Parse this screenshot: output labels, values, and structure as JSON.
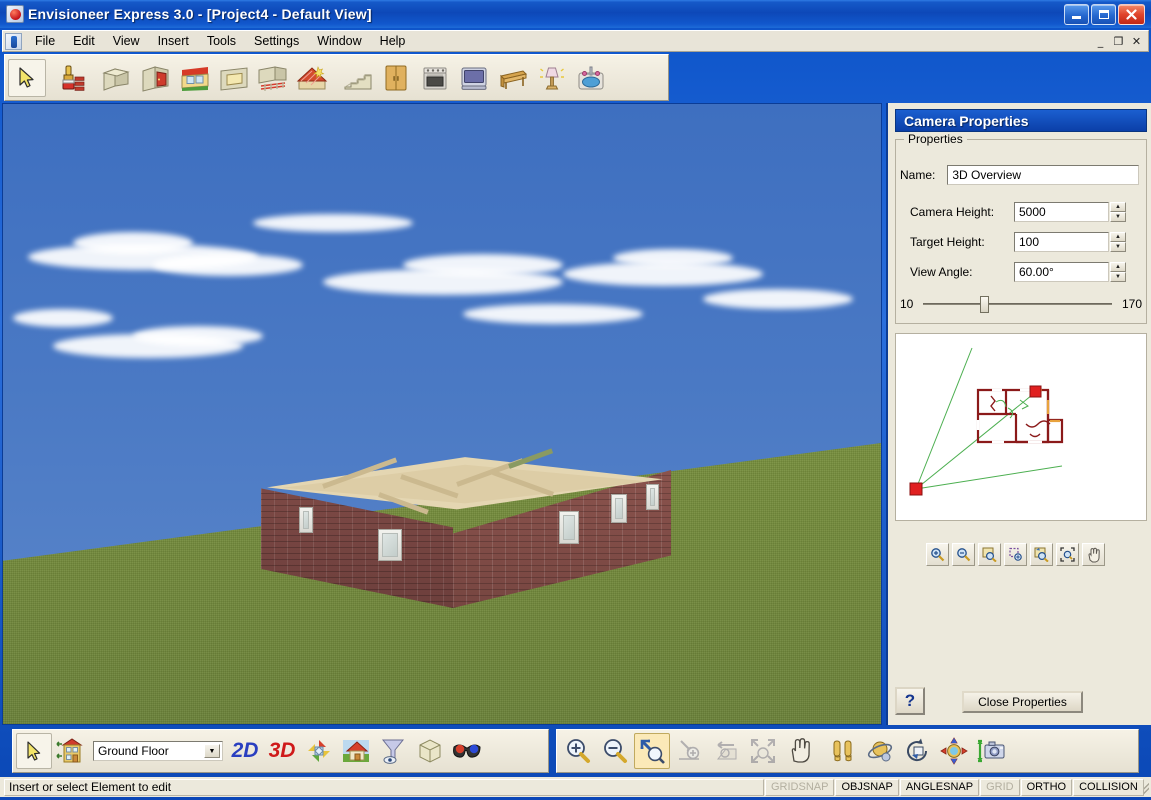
{
  "window": {
    "title": "Envisioneer Express 3.0 - [Project4 - Default View]",
    "app_icon": "app-icon",
    "minimize": "–",
    "maximize": "□",
    "close": "✕",
    "mdi_minimize": "_",
    "mdi_restore": "❐",
    "mdi_close": "✕"
  },
  "menu": {
    "items": [
      {
        "label": "File"
      },
      {
        "label": "Edit"
      },
      {
        "label": "View"
      },
      {
        "label": "Insert"
      },
      {
        "label": "Tools"
      },
      {
        "label": "Settings"
      },
      {
        "label": "Window"
      },
      {
        "label": "Help"
      }
    ]
  },
  "main_toolbar": {
    "buttons": [
      {
        "name": "select-arrow-tool",
        "title": "Select"
      },
      {
        "name": "paint-material-tool",
        "title": "Material / Paint"
      },
      {
        "name": "wall-tool",
        "title": "Wall"
      },
      {
        "name": "door-tool",
        "title": "Door"
      },
      {
        "name": "window-tool",
        "title": "Window"
      },
      {
        "name": "opening-tool",
        "title": "Opening"
      },
      {
        "name": "deck-railing-tool",
        "title": "Deck / Railing"
      },
      {
        "name": "roof-tool",
        "title": "Roof"
      },
      {
        "name": "stairs-tool",
        "title": "Stairs"
      },
      {
        "name": "cabinet-tool",
        "title": "Cabinet"
      },
      {
        "name": "appliance-tool",
        "title": "Appliance"
      },
      {
        "name": "electronics-tool",
        "title": "Electronics"
      },
      {
        "name": "furniture-tool",
        "title": "Furniture"
      },
      {
        "name": "lighting-tool",
        "title": "Lighting"
      },
      {
        "name": "plumbing-tool",
        "title": "Plumbing"
      }
    ]
  },
  "viewport": {
    "scene": "3d-exterior-brick-house-on-grass",
    "sky_color": "#4a79c4",
    "ground_color": "#7d9640",
    "brick_color": "#7e4a46",
    "floor_color": "#e4d6b2"
  },
  "panel": {
    "title": "Camera Properties",
    "group_label": "Properties",
    "fields": [
      {
        "label": "Name:",
        "value": "3D Overview",
        "spinner": false
      },
      {
        "label": "Camera Height:",
        "value": "5000",
        "spinner": true
      },
      {
        "label": "Target Height:",
        "value": "100",
        "spinner": true
      },
      {
        "label": "View Angle:",
        "value": "60.00°",
        "spinner": true
      }
    ],
    "slider": {
      "min": "10",
      "max": "170",
      "position_pct": 30
    },
    "preview": {
      "name": "floorplan-camera-preview",
      "camera_marker_color": "#e02020",
      "target_marker_color": "#e02020",
      "cone_color": "#4caf50",
      "plan_wall_color": "#8b1a1a"
    },
    "preview_toolbar": [
      {
        "name": "zoom-in-button"
      },
      {
        "name": "zoom-out-button"
      },
      {
        "name": "zoom-window-button"
      },
      {
        "name": "zoom-selected-button"
      },
      {
        "name": "zoom-previous-button"
      },
      {
        "name": "zoom-extents-button"
      },
      {
        "name": "pan-button"
      }
    ],
    "help_label": "?",
    "close_label": "Close Properties"
  },
  "bottom_toolbar_left": {
    "select_tool": "select-arrow-tool",
    "level_icon": "building-levels-icon",
    "floor_value": "Ground Floor",
    "floor_arrow": "▼",
    "view_2d": "2D",
    "view_3d": "3D",
    "buttons": [
      {
        "name": "refresh-views-button"
      },
      {
        "name": "render-house-button"
      },
      {
        "name": "display-filter-button"
      },
      {
        "name": "wireframe-cube-button"
      },
      {
        "name": "stereo-glasses-button"
      }
    ]
  },
  "bottom_toolbar_right": {
    "buttons": [
      {
        "name": "zoom-in-button"
      },
      {
        "name": "zoom-out-button"
      },
      {
        "name": "zoom-extents-button"
      },
      {
        "name": "zoom-window-button"
      },
      {
        "name": "zoom-previous-button"
      },
      {
        "name": "zoom-all-button"
      },
      {
        "name": "pan-button"
      },
      {
        "name": "walk-through-button"
      },
      {
        "name": "orbit-button"
      },
      {
        "name": "rotate-view-button"
      },
      {
        "name": "move-camera-button"
      },
      {
        "name": "camera-button"
      }
    ]
  },
  "statusbar": {
    "message": "Insert or select Element to edit",
    "toggles": [
      {
        "label": "GRIDSNAP",
        "active": false
      },
      {
        "label": "OBJSNAP",
        "active": true
      },
      {
        "label": "ANGLESNAP",
        "active": true
      },
      {
        "label": "GRID",
        "active": false
      },
      {
        "label": "ORTHO",
        "active": true
      },
      {
        "label": "COLLISION",
        "active": true
      }
    ]
  }
}
